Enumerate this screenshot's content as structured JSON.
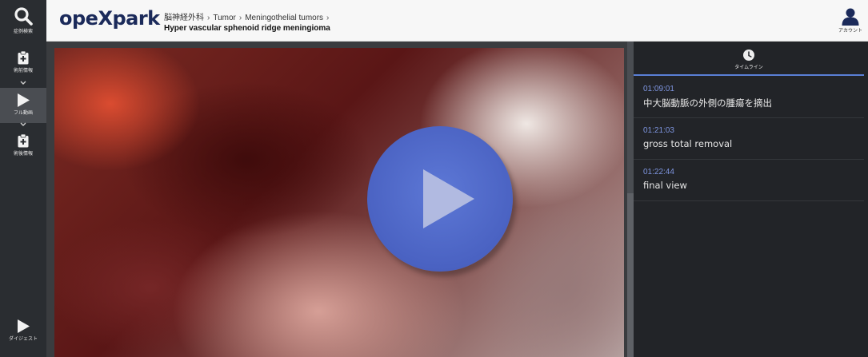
{
  "app": {
    "logo": "opeXpark"
  },
  "sidebar": {
    "items": [
      {
        "label": "症例検索",
        "icon": "search-icon"
      },
      {
        "label": "術前情報",
        "icon": "clipboard-plus-icon"
      },
      {
        "label": "フル動画",
        "icon": "play-icon"
      },
      {
        "label": "術後情報",
        "icon": "clipboard-plus-icon"
      },
      {
        "label": "ダイジェスト",
        "icon": "play-icon"
      }
    ]
  },
  "header": {
    "breadcrumb": [
      "脳神経外科",
      "Tumor",
      "Meningothelial tumors"
    ],
    "title": "Hyper vascular sphenoid ridge meningioma",
    "account_label": "アカウント"
  },
  "panel": {
    "tab_label": "タイムライン",
    "tab_icon": "clock-icon",
    "timeline": [
      {
        "time": "01:09:01",
        "text": "中大脳動脈の外側の腫瘍を摘出"
      },
      {
        "time": "01:21:03",
        "text": "gross total removal"
      },
      {
        "time": "01:22:44",
        "text": "final view"
      }
    ]
  },
  "colors": {
    "accent": "#5a7fd6",
    "timestamp": "#7e95e0",
    "logo": "#1b2a5a",
    "play_button": "#4a62c2"
  }
}
